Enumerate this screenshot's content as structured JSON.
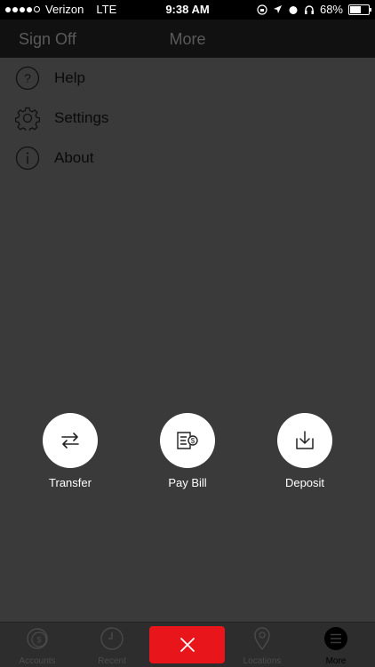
{
  "status_bar": {
    "carrier": "Verizon",
    "network": "LTE",
    "time": "9:38 AM",
    "battery": "68%",
    "battery_level": 0.68
  },
  "nav": {
    "sign_off": "Sign Off",
    "title": "More"
  },
  "menu": {
    "items": [
      {
        "label": "Help",
        "icon": "help-icon"
      },
      {
        "label": "Settings",
        "icon": "gear-icon"
      },
      {
        "label": "About",
        "icon": "info-icon"
      }
    ]
  },
  "actions": {
    "items": [
      {
        "label": "Transfer",
        "icon": "transfer-icon"
      },
      {
        "label": "Pay Bill",
        "icon": "pay-bill-icon"
      },
      {
        "label": "Deposit",
        "icon": "deposit-icon"
      }
    ]
  },
  "tabbar": {
    "items": [
      {
        "label": "Accounts",
        "icon": "accounts-icon"
      },
      {
        "label": "Recent",
        "icon": "clock-icon"
      },
      {
        "label": "Locations",
        "icon": "location-pin-icon"
      },
      {
        "label": "More",
        "icon": "menu-icon"
      }
    ],
    "close_icon": "close-icon",
    "accent_color": "#e8151b"
  }
}
